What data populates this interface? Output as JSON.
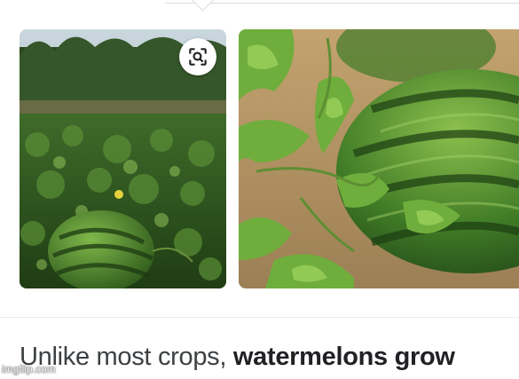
{
  "snippet": {
    "plain": "Unlike most crops, ",
    "bold": "watermelons grow"
  },
  "images": [
    {
      "name": "watermelon-field-image",
      "subject": "watermelon growing in a field"
    },
    {
      "name": "watermelon-closeup-image",
      "subject": "close-up of watermelon on vine"
    }
  ],
  "lens_button": {
    "icon": "lens-search-icon"
  },
  "watermark": "imgflip.com",
  "colors": {
    "text": "#3c4043",
    "bold_text": "#202124",
    "divider": "#e8eaed"
  }
}
